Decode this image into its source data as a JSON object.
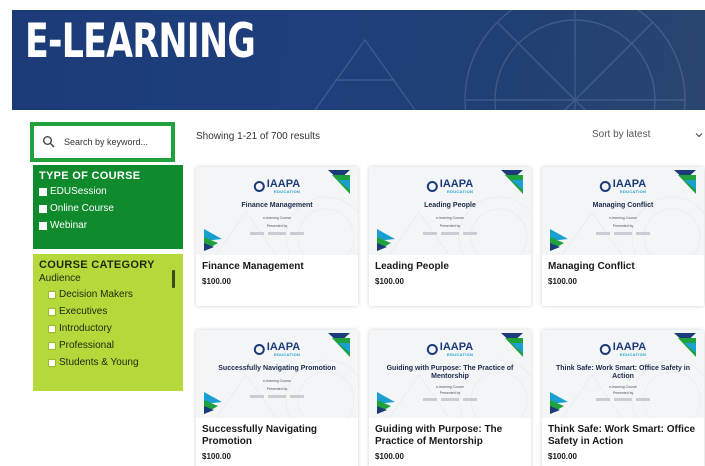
{
  "hero": {
    "title": "E-LEARNING"
  },
  "search": {
    "placeholder": "Search by keyword..."
  },
  "filters": {
    "type_heading": "TYPE OF COURSE",
    "type_options": [
      "EDUSession",
      "Online Course",
      "Webinar"
    ],
    "category_heading": "COURSE CATEGORY",
    "category_group": "Audience",
    "category_options": [
      "Decision Makers",
      "Executives",
      "Introductory",
      "Professional",
      "Students & Young"
    ]
  },
  "results": {
    "count_text": "Showing 1-21 of 700 results",
    "sort_label": "Sort by latest"
  },
  "thumbnail": {
    "logo_text": "IAAPA",
    "logo_subtext": "EDUCATION",
    "caption": "e-learning Course",
    "presented_by": "Presented by"
  },
  "courses": [
    {
      "thumb_title": "Finance Management",
      "title": "Finance Management",
      "price": "$100.00"
    },
    {
      "thumb_title": "Leading People",
      "title": "Leading People",
      "price": "$100.00"
    },
    {
      "thumb_title": "Managing Conflict",
      "title": "Managing Conflict",
      "price": "$100.00"
    },
    {
      "thumb_title": "Successfully Navigating Promotion",
      "title": "Successfully Navigating Promotion",
      "price": "$100.00"
    },
    {
      "thumb_title": "Guiding with Purpose: The Practice of Mentorship",
      "title": "Guiding with Purpose: The Practice of Mentorship",
      "price": "$100.00"
    },
    {
      "thumb_title": "Think Safe: Work Smart: Office Safety in Action",
      "title": "Think Safe: Work Smart: Office Safety in Action",
      "price": "$100.00"
    }
  ],
  "colors": {
    "hero_bg": "#1b3c78",
    "search_border": "#1fa23b",
    "type_panel_bg": "#0f8a2c",
    "category_panel_bg": "#b5d93a",
    "logo_navy": "#1b3c78",
    "logo_teal": "#1a9fd1"
  },
  "icons": {
    "search": "search-icon",
    "sort": "chevron-down-icon",
    "brand": "chevron-triangles-icon"
  }
}
